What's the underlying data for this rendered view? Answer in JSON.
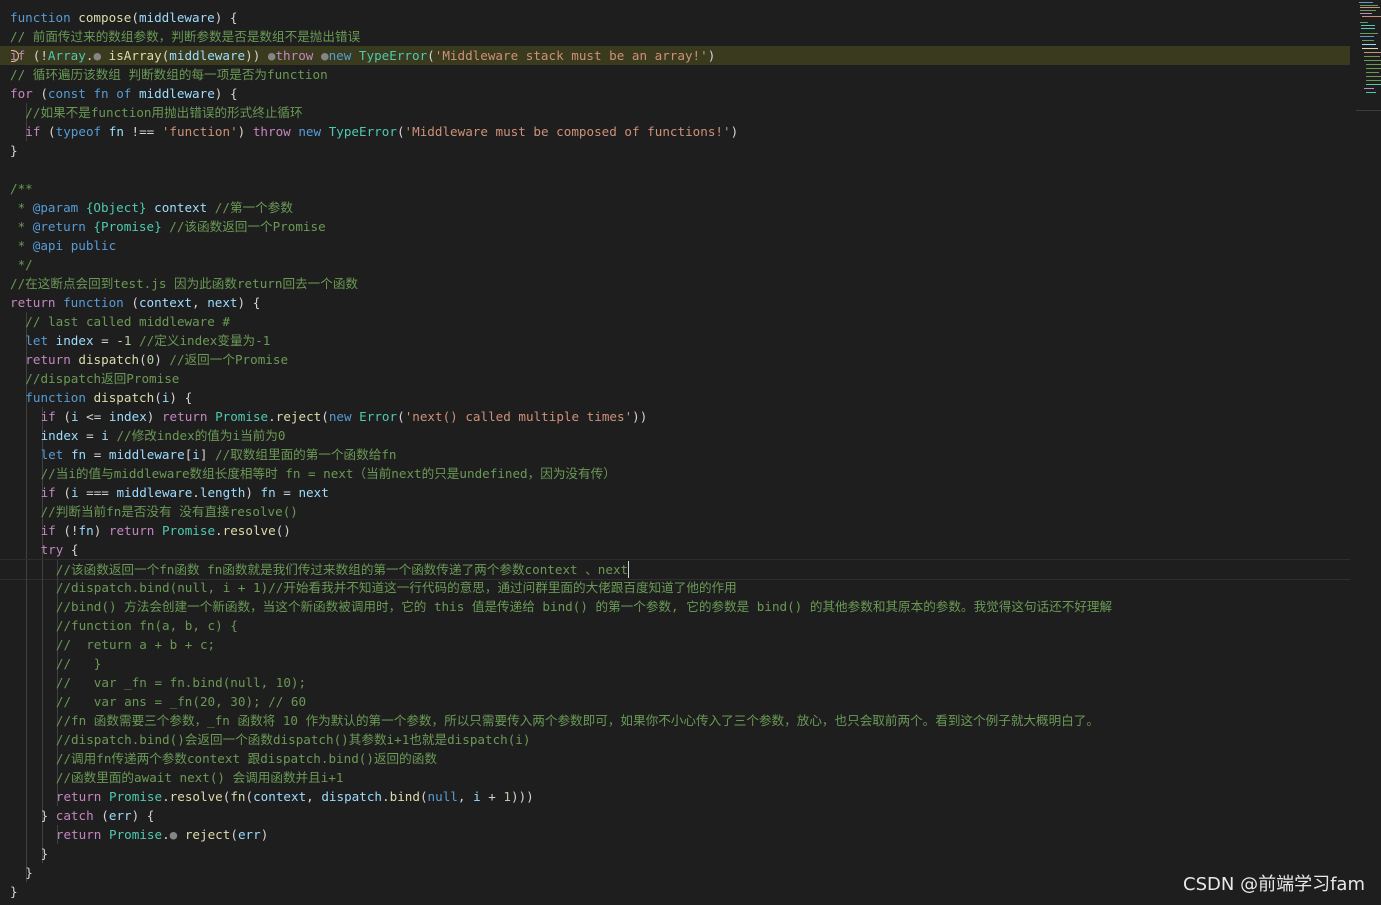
{
  "editor": {
    "lines": [
      {
        "indent": 0,
        "tokens": [
          [
            "kw",
            "function"
          ],
          [
            "p",
            " "
          ],
          [
            "fn",
            "compose"
          ],
          [
            "p",
            "("
          ],
          [
            "var",
            "middleware"
          ],
          [
            "p",
            ") {"
          ]
        ]
      },
      {
        "indent": 1,
        "tokens": [
          [
            "cm",
            "// 前面传过来的数组参数，判断参数是否是数组不是抛出错误"
          ]
        ]
      },
      {
        "indent": 1,
        "highlight": true,
        "breakpoint": true,
        "tokens": [
          [
            "ctl",
            "if"
          ],
          [
            "p",
            " (!"
          ],
          [
            "type",
            "Array"
          ],
          [
            "p",
            "."
          ],
          [
            "dot",
            "●"
          ],
          [
            "p",
            " "
          ],
          [
            "fn",
            "isArray"
          ],
          [
            "p",
            "("
          ],
          [
            "var",
            "middleware"
          ],
          [
            "p",
            ")) "
          ],
          [
            "dot",
            "●"
          ],
          [
            "ctl",
            "throw"
          ],
          [
            "p",
            " "
          ],
          [
            "dot",
            "●"
          ],
          [
            "kw",
            "new"
          ],
          [
            "p",
            " "
          ],
          [
            "type",
            "TypeError"
          ],
          [
            "p",
            "("
          ],
          [
            "str",
            "'Middleware stack must be an array!'"
          ],
          [
            "p",
            ")"
          ]
        ]
      },
      {
        "indent": 1,
        "tokens": [
          [
            "cm",
            "// 循环遍历该数组 判断数组的每一项是否为function"
          ]
        ]
      },
      {
        "indent": 1,
        "tokens": [
          [
            "ctl",
            "for"
          ],
          [
            "p",
            " ("
          ],
          [
            "kw",
            "const"
          ],
          [
            "p",
            " "
          ],
          [
            "kw",
            "fn"
          ],
          [
            "p",
            " "
          ],
          [
            "kw",
            "of"
          ],
          [
            "p",
            " "
          ],
          [
            "var",
            "middleware"
          ],
          [
            "p",
            ") {"
          ]
        ]
      },
      {
        "indent": 2,
        "tokens": [
          [
            "cm",
            "//如果不是function用抛出错误的形式终止循环"
          ]
        ]
      },
      {
        "indent": 2,
        "tokens": [
          [
            "ctl",
            "if"
          ],
          [
            "p",
            " ("
          ],
          [
            "kw",
            "typeof"
          ],
          [
            "p",
            " "
          ],
          [
            "var",
            "fn"
          ],
          [
            "p",
            " !== "
          ],
          [
            "str",
            "'function'"
          ],
          [
            "p",
            ") "
          ],
          [
            "ctl",
            "throw"
          ],
          [
            "p",
            " "
          ],
          [
            "kw",
            "new"
          ],
          [
            "p",
            " "
          ],
          [
            "type",
            "TypeError"
          ],
          [
            "p",
            "("
          ],
          [
            "str",
            "'Middleware must be composed of functions!'"
          ],
          [
            "p",
            ")"
          ]
        ]
      },
      {
        "indent": 1,
        "tokens": [
          [
            "p",
            "}"
          ]
        ]
      },
      {
        "indent": 1,
        "tokens": []
      },
      {
        "indent": 1,
        "tokens": [
          [
            "cm",
            "/**"
          ]
        ]
      },
      {
        "indent": 1,
        "tokens": [
          [
            "cm",
            " * "
          ],
          [
            "kw",
            "@param"
          ],
          [
            "p",
            " "
          ],
          [
            "type",
            "{Object}"
          ],
          [
            "p",
            " "
          ],
          [
            "var",
            "context"
          ],
          [
            "p",
            " "
          ],
          [
            "cm",
            "//第一个参数"
          ]
        ]
      },
      {
        "indent": 1,
        "tokens": [
          [
            "cm",
            " * "
          ],
          [
            "kw",
            "@return"
          ],
          [
            "p",
            " "
          ],
          [
            "type",
            "{Promise}"
          ],
          [
            "p",
            " "
          ],
          [
            "cm",
            "//该函数返回一个Promise"
          ]
        ]
      },
      {
        "indent": 1,
        "tokens": [
          [
            "cm",
            " * "
          ],
          [
            "kw",
            "@api"
          ],
          [
            "p",
            " "
          ],
          [
            "kw",
            "public"
          ]
        ]
      },
      {
        "indent": 1,
        "tokens": [
          [
            "cm",
            " */"
          ]
        ]
      },
      {
        "indent": 1,
        "tokens": [
          [
            "cm",
            "//在这断点会回到test.js 因为此函数return回去一个函数"
          ]
        ]
      },
      {
        "indent": 1,
        "tokens": [
          [
            "ctl",
            "return"
          ],
          [
            "p",
            " "
          ],
          [
            "kw",
            "function"
          ],
          [
            "p",
            " ("
          ],
          [
            "var",
            "context"
          ],
          [
            "p",
            ", "
          ],
          [
            "var",
            "next"
          ],
          [
            "p",
            ") {"
          ]
        ]
      },
      {
        "indent": 2,
        "tokens": [
          [
            "cm",
            "// last called middleware #"
          ]
        ]
      },
      {
        "indent": 2,
        "tokens": [
          [
            "kw",
            "let"
          ],
          [
            "p",
            " "
          ],
          [
            "var",
            "index"
          ],
          [
            "p",
            " = -"
          ],
          [
            "num",
            "1"
          ],
          [
            "p",
            " "
          ],
          [
            "cm",
            "//定义index变量为-1"
          ]
        ]
      },
      {
        "indent": 2,
        "tokens": [
          [
            "ctl",
            "return"
          ],
          [
            "p",
            " "
          ],
          [
            "fn",
            "dispatch"
          ],
          [
            "p",
            "("
          ],
          [
            "num",
            "0"
          ],
          [
            "p",
            ") "
          ],
          [
            "cm",
            "//返回一个Promise"
          ]
        ]
      },
      {
        "indent": 2,
        "tokens": [
          [
            "cm",
            "//dispatch返回Promise"
          ]
        ]
      },
      {
        "indent": 2,
        "tokens": [
          [
            "kw",
            "function"
          ],
          [
            "p",
            " "
          ],
          [
            "fn",
            "dispatch"
          ],
          [
            "p",
            "("
          ],
          [
            "var",
            "i"
          ],
          [
            "p",
            ") {"
          ]
        ]
      },
      {
        "indent": 3,
        "tokens": [
          [
            "ctl",
            "if"
          ],
          [
            "p",
            " ("
          ],
          [
            "var",
            "i"
          ],
          [
            "p",
            " <= "
          ],
          [
            "var",
            "index"
          ],
          [
            "p",
            ") "
          ],
          [
            "ctl",
            "return"
          ],
          [
            "p",
            " "
          ],
          [
            "type",
            "Promise"
          ],
          [
            "p",
            "."
          ],
          [
            "fn",
            "reject"
          ],
          [
            "p",
            "("
          ],
          [
            "kw",
            "new"
          ],
          [
            "p",
            " "
          ],
          [
            "type",
            "Error"
          ],
          [
            "p",
            "("
          ],
          [
            "str",
            "'next() called multiple times'"
          ],
          [
            "p",
            "))"
          ]
        ]
      },
      {
        "indent": 3,
        "tokens": [
          [
            "var",
            "index"
          ],
          [
            "p",
            " = "
          ],
          [
            "var",
            "i"
          ],
          [
            "p",
            " "
          ],
          [
            "cm",
            "//修改index的值为i当前为0"
          ]
        ]
      },
      {
        "indent": 3,
        "tokens": [
          [
            "kw",
            "let"
          ],
          [
            "p",
            " "
          ],
          [
            "var",
            "fn"
          ],
          [
            "p",
            " = "
          ],
          [
            "var",
            "middleware"
          ],
          [
            "p",
            "["
          ],
          [
            "var",
            "i"
          ],
          [
            "p",
            "] "
          ],
          [
            "cm",
            "//取数组里面的第一个函数给fn"
          ]
        ]
      },
      {
        "indent": 3,
        "tokens": [
          [
            "cm",
            "//当i的值与middleware数组长度相等时 fn = next（当前next的只是undefined，因为没有传）"
          ]
        ]
      },
      {
        "indent": 3,
        "tokens": [
          [
            "ctl",
            "if"
          ],
          [
            "p",
            " ("
          ],
          [
            "var",
            "i"
          ],
          [
            "p",
            " === "
          ],
          [
            "var",
            "middleware"
          ],
          [
            "p",
            "."
          ],
          [
            "var",
            "length"
          ],
          [
            "p",
            ") "
          ],
          [
            "var",
            "fn"
          ],
          [
            "p",
            " = "
          ],
          [
            "var",
            "next"
          ]
        ]
      },
      {
        "indent": 3,
        "tokens": [
          [
            "cm",
            "//判断当前fn是否没有 没有直接resolve()"
          ]
        ]
      },
      {
        "indent": 3,
        "tokens": [
          [
            "ctl",
            "if"
          ],
          [
            "p",
            " (!"
          ],
          [
            "var",
            "fn"
          ],
          [
            "p",
            ") "
          ],
          [
            "ctl",
            "return"
          ],
          [
            "p",
            " "
          ],
          [
            "type",
            "Promise"
          ],
          [
            "p",
            "."
          ],
          [
            "fn",
            "resolve"
          ],
          [
            "p",
            "()"
          ]
        ]
      },
      {
        "indent": 3,
        "tokens": [
          [
            "ctl",
            "try"
          ],
          [
            "p",
            " {"
          ]
        ]
      },
      {
        "indent": 4,
        "current": true,
        "tokens": [
          [
            "cm",
            "//该函数返回一个fn函数 fn函数就是我们传过来数组的第一个函数传递了两个参数context 、next"
          ]
        ]
      },
      {
        "indent": 4,
        "tokens": [
          [
            "cm",
            "//dispatch.bind(null, i + 1)//开始看我并不知道这一行代码的意思，通过问群里面的大佬跟百度知道了他的作用"
          ]
        ]
      },
      {
        "indent": 4,
        "tokens": [
          [
            "cm",
            "//bind() 方法会创建一个新函数，当这个新函数被调用时，它的 this 值是传递给 bind() 的第一个参数, 它的参数是 bind() 的其他参数和其原本的参数。我觉得这句话还不好理解"
          ]
        ]
      },
      {
        "indent": 4,
        "tokens": [
          [
            "cm",
            "//function fn(a, b, c) {"
          ]
        ]
      },
      {
        "indent": 4,
        "tokens": [
          [
            "cm",
            "//  return a + b + c;"
          ]
        ]
      },
      {
        "indent": 4,
        "tokens": [
          [
            "cm",
            "//   }"
          ]
        ]
      },
      {
        "indent": 4,
        "tokens": [
          [
            "cm",
            "//   var _fn = fn.bind(null, 10);"
          ]
        ]
      },
      {
        "indent": 4,
        "tokens": [
          [
            "cm",
            "//   var ans = _fn(20, 30); // 60"
          ]
        ]
      },
      {
        "indent": 4,
        "tokens": [
          [
            "cm",
            "//fn 函数需要三个参数，_fn 函数将 10 作为默认的第一个参数，所以只需要传入两个参数即可，如果你不小心传入了三个参数，放心，也只会取前两个。看到这个例子就大概明白了。"
          ]
        ]
      },
      {
        "indent": 4,
        "tokens": [
          [
            "cm",
            "//dispatch.bind()会返回一个函数dispatch()其参数i+1也就是dispatch(i)"
          ]
        ]
      },
      {
        "indent": 4,
        "tokens": [
          [
            "cm",
            "//调用fn传递两个参数context 跟dispatch.bind()返回的函数"
          ]
        ]
      },
      {
        "indent": 4,
        "tokens": [
          [
            "cm",
            "//函数里面的await next() 会调用函数并且i+1"
          ]
        ]
      },
      {
        "indent": 4,
        "tokens": [
          [
            "ctl",
            "return"
          ],
          [
            "p",
            " "
          ],
          [
            "type",
            "Promise"
          ],
          [
            "p",
            "."
          ],
          [
            "fn",
            "resolve"
          ],
          [
            "p",
            "("
          ],
          [
            "fn",
            "fn"
          ],
          [
            "p",
            "("
          ],
          [
            "var",
            "context"
          ],
          [
            "p",
            ", "
          ],
          [
            "var",
            "dispatch"
          ],
          [
            "p",
            "."
          ],
          [
            "fn",
            "bind"
          ],
          [
            "p",
            "("
          ],
          [
            "kw",
            "null"
          ],
          [
            "p",
            ", "
          ],
          [
            "var",
            "i"
          ],
          [
            "p",
            " + "
          ],
          [
            "num",
            "1"
          ],
          [
            "p",
            ")))"
          ]
        ]
      },
      {
        "indent": 3,
        "tokens": [
          [
            "p",
            "} "
          ],
          [
            "ctl",
            "catch"
          ],
          [
            "p",
            " ("
          ],
          [
            "var",
            "err"
          ],
          [
            "p",
            ") {"
          ]
        ]
      },
      {
        "indent": 4,
        "tokens": [
          [
            "ctl",
            "return"
          ],
          [
            "p",
            " "
          ],
          [
            "type",
            "Promise"
          ],
          [
            "p",
            "."
          ],
          [
            "dot",
            "●"
          ],
          [
            "p",
            " "
          ],
          [
            "fn",
            "reject"
          ],
          [
            "p",
            "("
          ],
          [
            "var",
            "err"
          ],
          [
            "p",
            ")"
          ]
        ]
      },
      {
        "indent": 3,
        "tokens": [
          [
            "p",
            "}"
          ]
        ]
      },
      {
        "indent": 2,
        "tokens": [
          [
            "p",
            "}"
          ]
        ]
      },
      {
        "indent": 1,
        "tokens": [
          [
            "p",
            "}"
          ]
        ]
      }
    ]
  },
  "watermark": "CSDN @前端学习fam",
  "colors": {
    "background": "#1e1e1e",
    "keyword": "#569cd6",
    "control": "#c586c0",
    "function": "#dcdcaa",
    "variable": "#9cdcfe",
    "type": "#4ec9b0",
    "string": "#ce9178",
    "number": "#b5cea8",
    "comment": "#6a9955",
    "breakpoint_highlight": "#3a3a1e"
  }
}
